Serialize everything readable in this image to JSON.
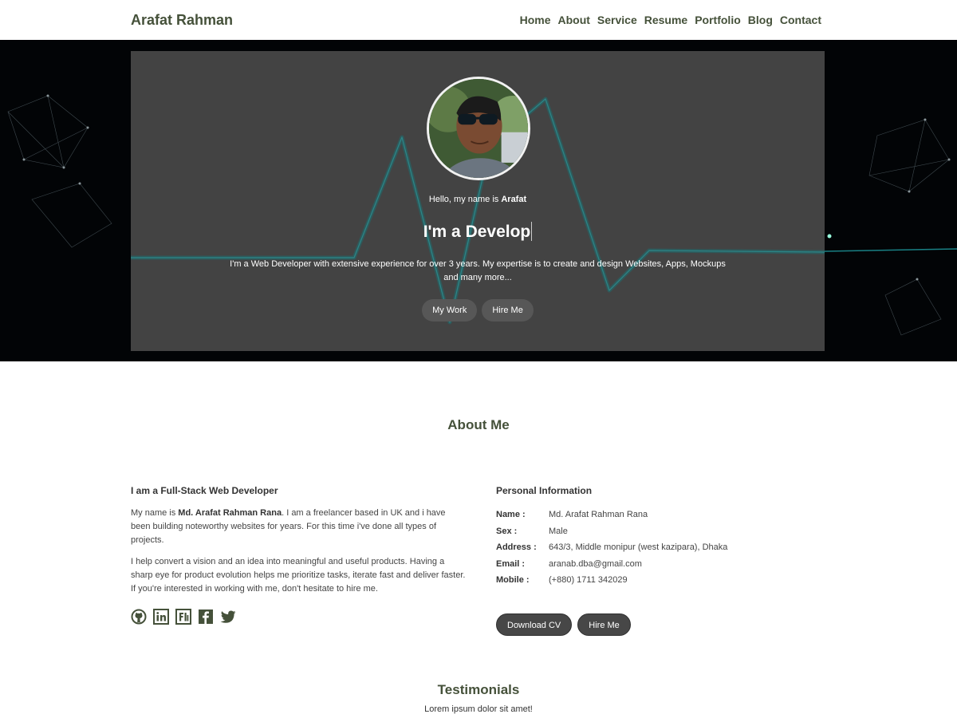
{
  "header": {
    "brand": "Arafat Rahman",
    "nav": [
      "Home",
      "About",
      "Service",
      "Resume",
      "Portfolio",
      "Blog",
      "Contact"
    ]
  },
  "hero": {
    "hello_prefix": "Hello, my name is ",
    "hello_name": "Arafat",
    "typed_role": "I'm a Develop",
    "intro": "I'm a Web Developer with extensive experience for over 3 years. My expertise is to create and design Websites, Apps, Mockups and many more...",
    "buttons": [
      "My Work",
      "Hire Me"
    ]
  },
  "about": {
    "title": "About Me",
    "left": {
      "heading": "I am a Full-Stack Web Developer",
      "p1_prefix": "My name is ",
      "p1_name": "Md. Arafat Rahman Rana",
      "p1_suffix": ". I am a freelancer based in UK and i have been building noteworthy websites for years. For this time i've done all types of projects.",
      "p2": "I help convert a vision and an idea into meaningful and useful products. Having a sharp eye for product evolution helps me prioritize tasks, iterate fast and deliver faster. If you're interested in working with me, don't hesitate to hire me.",
      "social_icons": [
        "github-icon",
        "linkedin-icon",
        "freelancer-icon",
        "facebook-icon",
        "twitter-icon"
      ]
    },
    "right": {
      "heading": "Personal Information",
      "info": [
        {
          "key": "Name :",
          "value": "Md. Arafat Rahman Rana"
        },
        {
          "key": "Sex :",
          "value": "Male"
        },
        {
          "key": "Address :",
          "value": "643/3, Middle monipur (west kazipara), Dhaka"
        },
        {
          "key": "Email :",
          "value": "aranab.dba@gmail.com"
        },
        {
          "key": "Mobile :",
          "value": "(+880) 1711 342029"
        }
      ],
      "buttons": [
        "Download CV",
        "Hire Me"
      ]
    }
  },
  "testimonials": {
    "title": "Testimonials",
    "subtitle": "Lorem ipsum dolor sit amet!"
  },
  "colors": {
    "brand_green": "#45513a",
    "hero_teal": "#1d8a8a",
    "hero_card": "#484848"
  }
}
